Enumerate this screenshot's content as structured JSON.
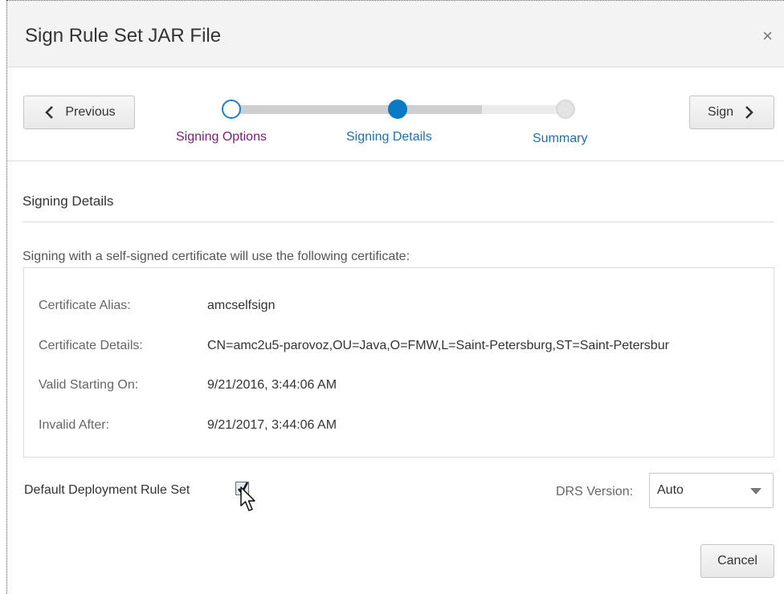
{
  "dialog": {
    "title": "Sign Rule Set JAR File",
    "close_symbol": "×"
  },
  "train": {
    "previous_label": "Previous",
    "next_label": "Sign",
    "steps": [
      {
        "label": "Signing Options",
        "state": "visited"
      },
      {
        "label": "Signing Details",
        "state": "current"
      },
      {
        "label": "Summary",
        "state": "unvisited"
      }
    ]
  },
  "details": {
    "section_title": "Signing Details",
    "intro_text": "Signing with a self-signed certificate will use the following certificate:",
    "rows": [
      {
        "label": "Certificate Alias:",
        "value": "amcselfsign"
      },
      {
        "label": "Certificate Details:",
        "value": "CN=amc2u5-parovoz,OU=Java,O=FMW,L=Saint-Petersburg,ST=Saint-Petersbur"
      },
      {
        "label": "Valid Starting On:",
        "value": "9/21/2016, 3:44:06 AM"
      },
      {
        "label": "Invalid After:",
        "value": "9/21/2017, 3:44:06 AM"
      }
    ]
  },
  "options": {
    "default_rule_set_label": "Default Deployment Rule Set",
    "default_rule_set_checked": true,
    "drs_version_label": "DRS Version:",
    "drs_version_value": "Auto"
  },
  "footer": {
    "cancel_label": "Cancel"
  },
  "colors": {
    "accent": "#0b7ac6",
    "visited_step": "#7b1c7c",
    "step_link": "#1f6fb3"
  }
}
